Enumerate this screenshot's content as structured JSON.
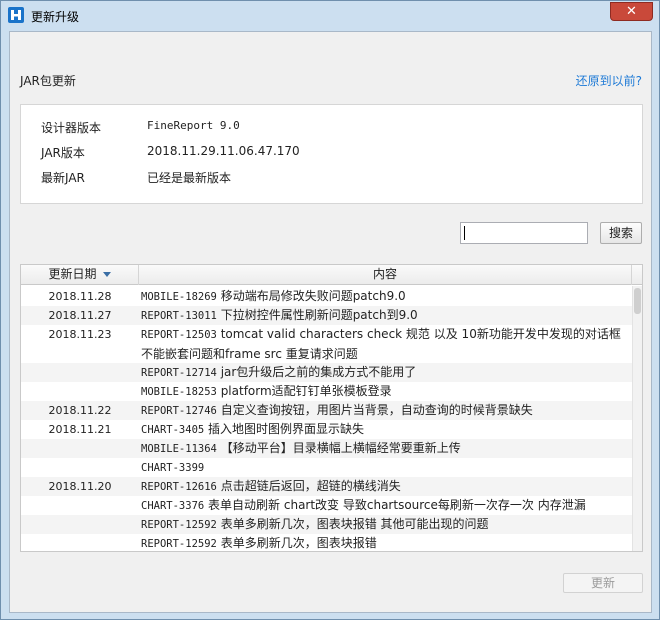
{
  "window": {
    "title": "更新升级",
    "close_glyph": "✕"
  },
  "section": {
    "label": "JAR包更新",
    "restore_link": "还原到以前?"
  },
  "info": [
    {
      "key": "设计器版本",
      "value": "FineReport 9.0"
    },
    {
      "key": "JAR版本",
      "value": "2018.11.29.11.06.47.170"
    },
    {
      "key": "最新JAR",
      "value": "已经是最新版本"
    }
  ],
  "search": {
    "value": "",
    "button": "搜索"
  },
  "table": {
    "col_date": "更新日期",
    "col_content": "内容",
    "rows": [
      {
        "date": "2018.11.28",
        "code": "MOBILE-18269",
        "text": "移动端布局修改失败问题patch9.0"
      },
      {
        "date": "2018.11.27",
        "code": "REPORT-13011",
        "text": "下拉树控件属性刷新问题patch到9.0"
      },
      {
        "date": "2018.11.23",
        "code": "REPORT-12503",
        "text": "tomcat valid characters check 规范 以及 10新功能开发中发现的对话框不能嵌套问题和frame src 重复请求问题"
      },
      {
        "date": "",
        "code": "REPORT-12714",
        "text": "jar包升级后之前的集成方式不能用了"
      },
      {
        "date": "",
        "code": "MOBILE-18253",
        "text": "platform适配钉钉单张模板登录"
      },
      {
        "date": "2018.11.22",
        "code": "REPORT-12746",
        "text": "自定义查询按钮，用图片当背景，自动查询的时候背景缺失"
      },
      {
        "date": "2018.11.21",
        "code": "CHART-3405",
        "text": "插入地图时图例界面显示缺失"
      },
      {
        "date": "",
        "code": "MOBILE-11364",
        "text": "【移动平台】目录横幅上横幅经常要重新上传"
      },
      {
        "date": "",
        "code": "CHART-3399",
        "text": ""
      },
      {
        "date": "2018.11.20",
        "code": "REPORT-12616",
        "text": "点击超链后返回，超链的横线消失"
      },
      {
        "date": "",
        "code": "CHART-3376",
        "text": "表单自动刷新 chart改变 导致chartsource每刷新一次存一次 内存泄漏"
      },
      {
        "date": "",
        "code": "REPORT-12592",
        "text": "表单多刷新几次，图表块报错 其他可能出现的问题"
      },
      {
        "date": "",
        "code": "REPORT-12592",
        "text": "表单多刷新几次，图表块报错"
      }
    ]
  },
  "footer": {
    "update_button": "更新"
  },
  "colors": {
    "titlebar": "#ccdff0",
    "link": "#1e7ad6",
    "close": "#c9493a",
    "logo": "#1a73c9"
  }
}
